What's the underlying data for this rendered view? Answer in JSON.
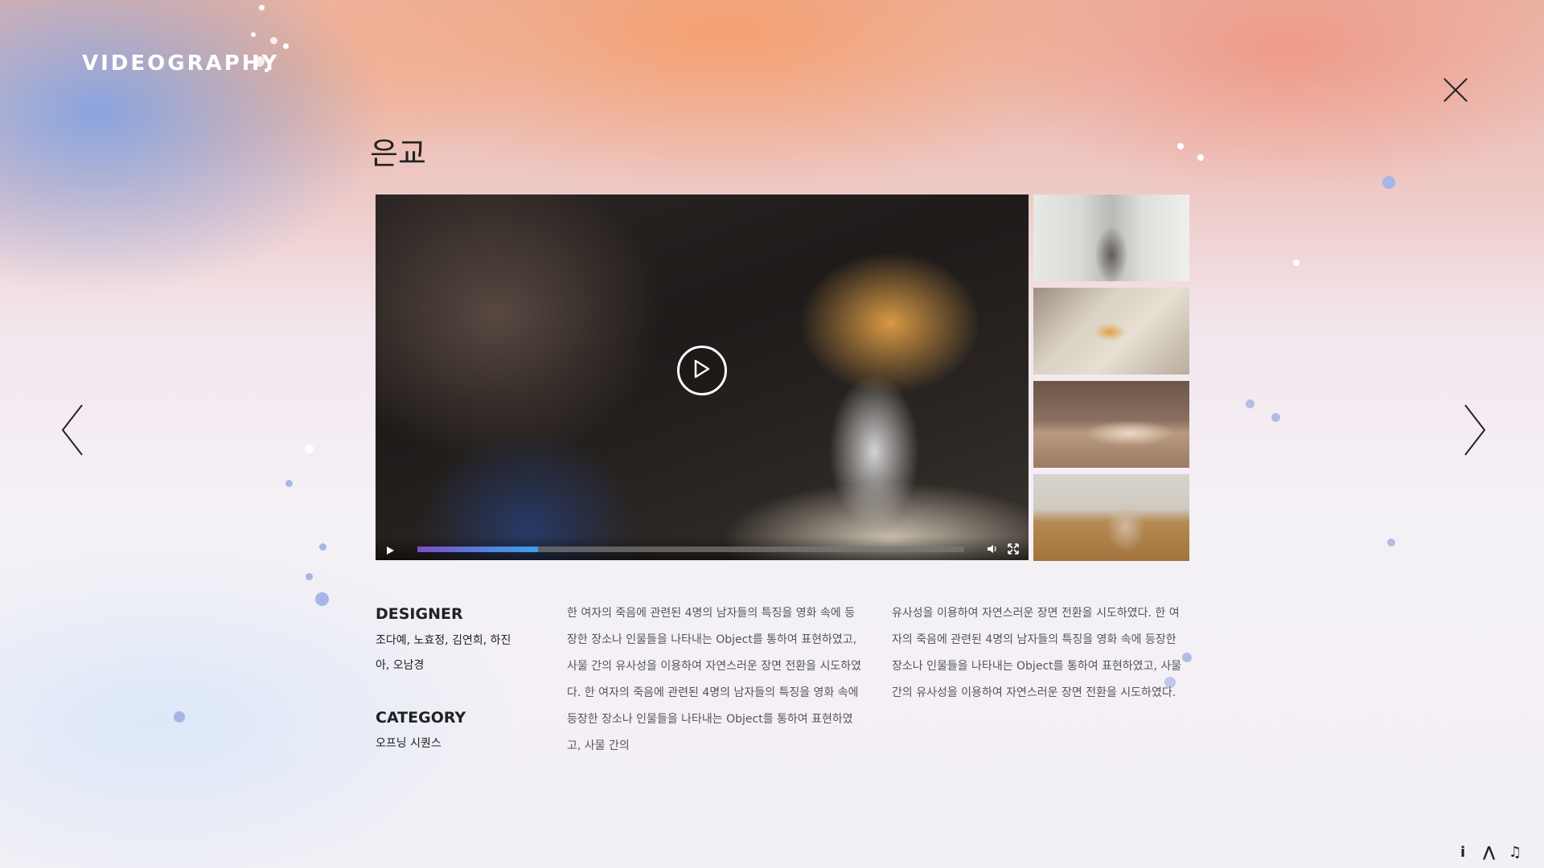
{
  "header": {
    "brand": "VIDEOGRAPHY"
  },
  "project": {
    "title": "은교",
    "designer_heading": "DESIGNER",
    "designer_names": "조다예, 노효정, 김연희, 하진아, 오남경",
    "category_heading": "CATEGORY",
    "category_value": "오프닝 시퀀스",
    "description_col1": "한 여자의 죽음에 관련된 4명의 남자들의 특징을 영화 속에 등장한 장소나 인물들을 나타내는 Object를 통하여 표현하였고, 사물 간의 유사성을 이용하여 자연스러운 장면 전환을 시도하였다. 한 여자의 죽음에 관련된 4명의 남자들의 특징을 영화 속에 등장한 장소나 인물들을 나타내는 Object를 통하여 표현하였고, 사물 간의",
    "description_col2": "유사성을 이용하여 자연스러운 장면 전환을 시도하였다. 한 여자의 죽음에 관련된 4명의 남자들의 특징을 영화 속에 등장한 장소나 인물들을 나타내는 Object를 통하여 표현하였고, 사물 간의 유사성을 이용하여 자연스러운 장면 전환을 시도하였다."
  },
  "player": {
    "progress": 0.22
  },
  "icons": {
    "close": "close-icon",
    "prev": "chevron-left-icon",
    "next": "chevron-right-icon",
    "play": "play-icon",
    "volume": "volume-icon",
    "fullscreen": "fullscreen-icon"
  },
  "footer": {
    "info_label": "i",
    "mountain_label": "⋀",
    "music_label": "♫"
  },
  "colors": {
    "accent_start": "#7b4fc9",
    "accent_end": "#3aa3e8",
    "text": "#222222"
  }
}
